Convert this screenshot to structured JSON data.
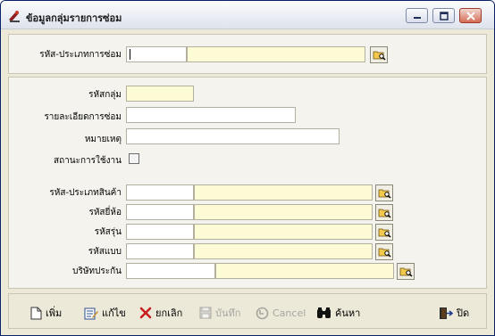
{
  "window": {
    "title": "ข้อมูลกลุ่มรายการซ่อม"
  },
  "top_panel": {
    "repair_type_label": "รหัส-ประเภทการซ่อม"
  },
  "form": {
    "group_code_label": "รหัสกลุ่ม",
    "detail_label": "รายละเอียดการซ่อม",
    "remark_label": "หมายเหตุ",
    "status_label": "สถานะการใช้งาน",
    "product_type_label": "รหัส-ประเภทสินค้า",
    "brand_label": "รหัสยี่ห้อ",
    "model_label": "รหัสรุ่น",
    "style_label": "รหัสแบบ",
    "insurance_label": "บริษัทประกัน"
  },
  "toolbar": {
    "add_label": "เพิ่ม",
    "edit_label": "แก้ไข",
    "cancel_record_label": "ยกเลิก",
    "save_label": "บันทึก",
    "cancel_label": "Cancel",
    "search_label": "ค้นหา",
    "close_label": "ปิด"
  }
}
